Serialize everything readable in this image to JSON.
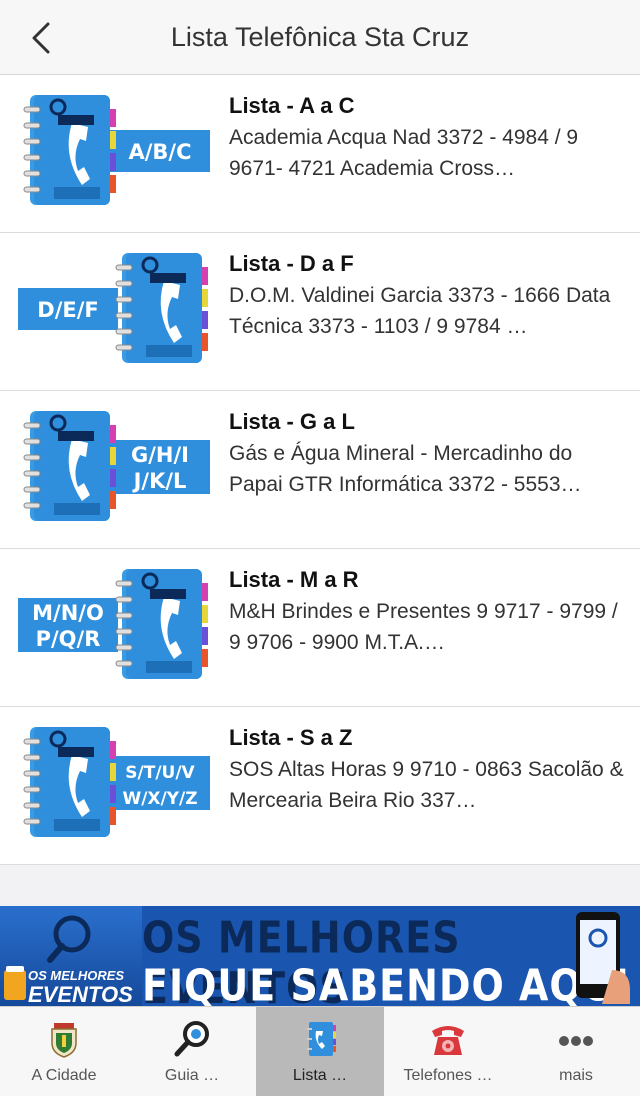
{
  "header": {
    "title": "Lista Telefônica Sta Cruz",
    "back_icon": "chevron-left-icon"
  },
  "rows": [
    {
      "title": "Lista - A a C",
      "desc": "Academia Acqua Nad 3372 - 4984 / 9 9671- 4721 Academia Cross…",
      "thumb_letters": [
        "A/B/C"
      ],
      "thumb_side": "right"
    },
    {
      "title": "Lista - D a F",
      "desc": "D.O.M. Valdinei Garcia 3373 - 1666 Data Técnica 3373 - 1103 / 9 9784 …",
      "thumb_letters": [
        "D/E/F"
      ],
      "thumb_side": "left"
    },
    {
      "title": "Lista - G a L",
      "desc": "Gás e Água Mineral - Mercadinho do Papai GTR Informática 3372 - 5553…",
      "thumb_letters": [
        "G/H/I",
        "J/K/L"
      ],
      "thumb_side": "right"
    },
    {
      "title": "Lista - M a R",
      "desc": "M&H Brindes e Presentes 9 9717 - 9799 / 9 9706 - 9900 M.T.A.…",
      "thumb_letters": [
        "M/N/O",
        "P/Q/R"
      ],
      "thumb_side": "left"
    },
    {
      "title": "Lista - S a Z",
      "desc": "SOS Altas Horas 9 9710 - 0863 Sacolão & Mercearia Beira Rio 337…",
      "thumb_letters": [
        "S/T/U/V",
        "W/X/Y/Z"
      ],
      "thumb_side": "right"
    }
  ],
  "banner": {
    "line1": "OS MELHORES EVENTOS",
    "line2": "FIQUE SABENDO AQUI",
    "sub1": "OS MELHORES",
    "sub2": "EVENTOS"
  },
  "tabs": [
    {
      "label": "A Cidade",
      "icon": "city-crest-icon",
      "active": false
    },
    {
      "label": "Guia …",
      "icon": "magnifier-icon",
      "active": false
    },
    {
      "label": "Lista …",
      "icon": "phonebook-icon",
      "active": true
    },
    {
      "label": "Telefones …",
      "icon": "telephone-icon",
      "active": false
    },
    {
      "label": "mais",
      "icon": "more-dots-icon",
      "active": false
    }
  ],
  "colors": {
    "accent_blue": "#2f8fdc",
    "banner_blue": "#1a56b0",
    "active_tab": "#b9b9b9"
  }
}
